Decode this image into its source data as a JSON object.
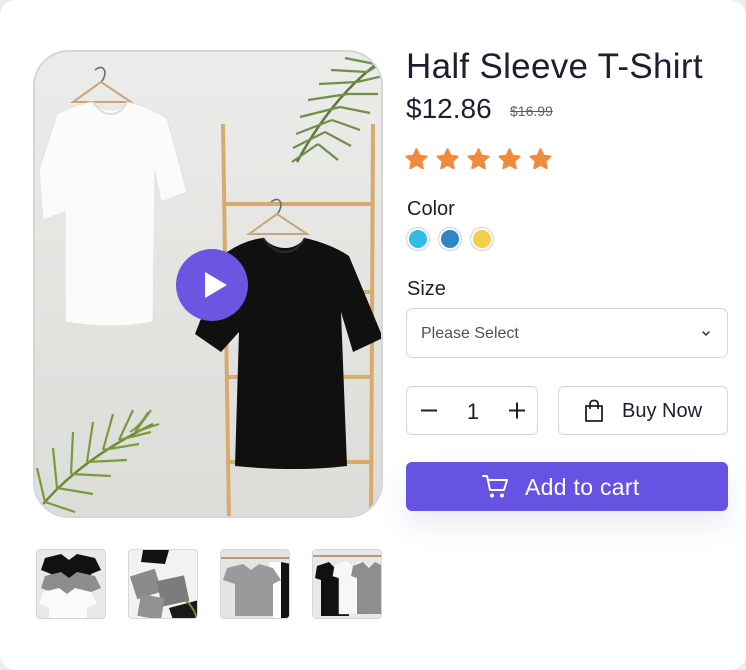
{
  "product": {
    "title": "Half Sleeve T-Shirt",
    "price": "$12.86",
    "original_price": "$16.99",
    "rating": 5,
    "rating_max": 5,
    "star_color": "#f08a3c"
  },
  "media": {
    "main_image": "clothes-rack-photo",
    "play_icon": "play-icon",
    "thumbnails": [
      "tshirts-on-hangers",
      "folded-tshirts",
      "grey-tshirt-rack",
      "black-white-tshirts-rack"
    ]
  },
  "color": {
    "label": "Color",
    "options": [
      "#30bde4",
      "#2e86c8",
      "#f5cf4c"
    ]
  },
  "size": {
    "label": "Size",
    "placeholder": "Please Select"
  },
  "quantity": {
    "value": "1",
    "decrement_icon": "minus-icon",
    "increment_icon": "plus-icon"
  },
  "actions": {
    "buy_now_label": "Buy Now",
    "buy_now_icon": "shopping-bag-icon",
    "add_to_cart_label": "Add to cart",
    "add_to_cart_icon": "cart-icon",
    "accent": "#6652e3"
  }
}
